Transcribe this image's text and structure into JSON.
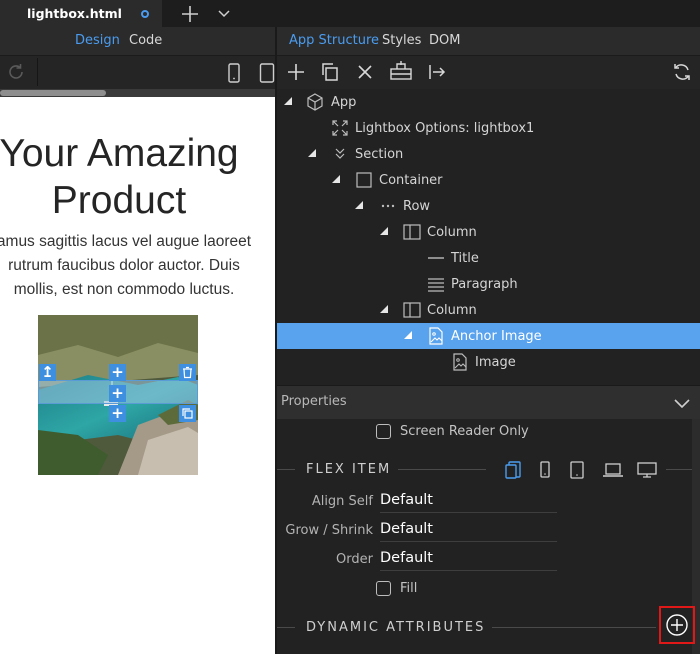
{
  "editor_tab": {
    "title": "lightbox.html",
    "add_label": "+"
  },
  "design_view": {
    "modes": {
      "design": "Design",
      "code": "Code"
    },
    "hero_title_line1": "Your Amazing",
    "hero_title_line2": "Product",
    "paragraph_lines": [
      "amus sagittis lacus vel augue laoreet",
      "rutrum faucibus dolor auctor. Duis",
      "mollis, est non commodo luctus."
    ],
    "image_handle_glyphs": {
      "up": "↥",
      "plus": "+",
      "delete": "🗑",
      "copy": "⧉"
    }
  },
  "panel_tabs": {
    "app_structure": "App Structure",
    "styles": "Styles",
    "dom": "DOM"
  },
  "tree": [
    {
      "label": "App",
      "icon": "cube-icon"
    },
    {
      "label": "Lightbox Options: lightbox1",
      "icon": "expand-icon"
    },
    {
      "label": "Section",
      "icon": "section-chevrons-icon"
    },
    {
      "label": "Container",
      "icon": "square-icon"
    },
    {
      "label": "Row",
      "icon": "dots-icon"
    },
    {
      "label": "Column",
      "icon": "column-icon"
    },
    {
      "label": "Title",
      "icon": "line-icon"
    },
    {
      "label": "Paragraph",
      "icon": "paragraph-icon"
    },
    {
      "label": "Column",
      "icon": "column-icon"
    },
    {
      "label": "Anchor Image",
      "icon": "image-icon",
      "selected": true
    },
    {
      "label": "Image",
      "icon": "image-icon"
    }
  ],
  "properties": {
    "header": "Properties",
    "screen_reader_only": "Screen Reader Only",
    "flex_item": {
      "title": "FLEX ITEM",
      "align_self": {
        "label": "Align Self",
        "value": "Default"
      },
      "grow_shrink": {
        "label": "Grow / Shrink",
        "value": "Default"
      },
      "order": {
        "label": "Order",
        "value": "Default"
      },
      "fill_label": "Fill"
    },
    "dynamic_attributes": {
      "title": "DYNAMIC ATTRIBUTES"
    }
  },
  "colors": {
    "accent": "#4a9cf0",
    "selection": "#58a2ee",
    "highlight_box": "#e01818"
  }
}
